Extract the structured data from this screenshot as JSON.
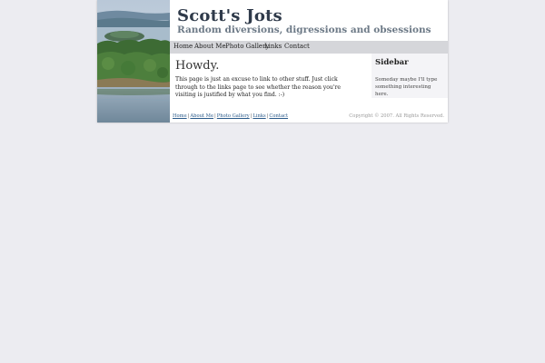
{
  "header": {
    "title": "Scott's Jots",
    "tagline": "Random diversions, digressions and obsessions"
  },
  "nav": {
    "home": "Home",
    "about": "About Me",
    "gallery": "Photo Gallery",
    "links": "Links",
    "contact": "Contact"
  },
  "main": {
    "heading": "Howdy.",
    "body": "This page is just an excuse to link to other stuff. Just click through to the links page to see whether the reason you're visiting is justified by what you find.   :-)"
  },
  "sidebar": {
    "heading": "Sidebar",
    "body": "Someday maybe I'll type something interesting here."
  },
  "footer": {
    "home": "Home",
    "about": "About Me",
    "gallery": "Photo Gallery",
    "links": "Links",
    "contact": "Contact",
    "separator": "|",
    "copyright": "Copyright © 2007. All Rights Reserved."
  },
  "colors": {
    "background": "#ececf1",
    "nav_bar": "#d5d6da",
    "sidebar_bg": "#f4f4f7",
    "link": "#2a5a8a"
  }
}
